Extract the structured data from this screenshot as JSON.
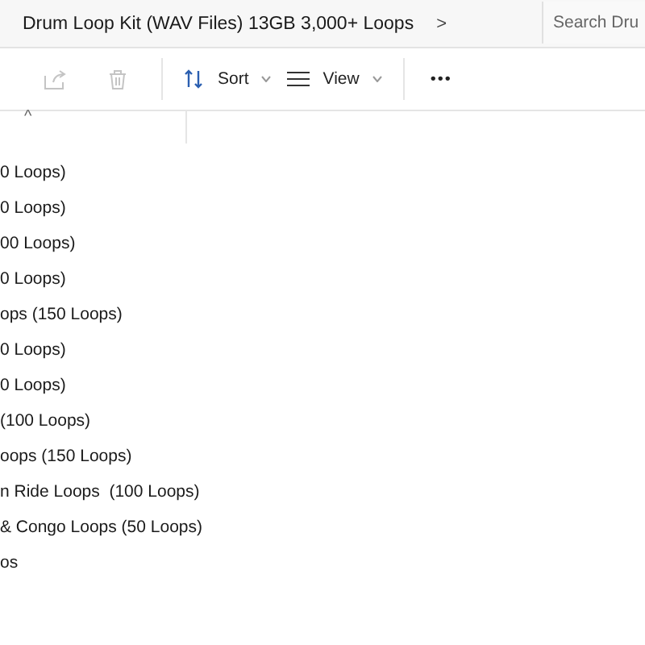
{
  "address_bar": {
    "path": "Drum Loop Kit (WAV Files) 13GB 3,000+ Loops",
    "chevron": ">"
  },
  "search": {
    "placeholder": "Search Dru"
  },
  "toolbar": [
    {
      "kind": "share",
      "disabled": true
    },
    {
      "kind": "delete",
      "disabled": true
    },
    {
      "kind": "sort",
      "label": "Sort"
    },
    {
      "kind": "view",
      "label": "View"
    },
    {
      "kind": "more",
      "label": "•••"
    }
  ],
  "sort_indicator": "^",
  "files": [
    {
      "name": "0 Loops)"
    },
    {
      "name": "0 Loops)"
    },
    {
      "name": "00 Loops)"
    },
    {
      "name": "0 Loops)"
    },
    {
      "name": "ops (150 Loops)"
    },
    {
      "name": "0 Loops)"
    },
    {
      "name": "0 Loops)"
    },
    {
      "name": "(100 Loops)"
    },
    {
      "name": "oops (150 Loops)"
    },
    {
      "name": "n Ride Loops  (100 Loops)"
    },
    {
      "name": "& Congo Loops (50 Loops)"
    },
    {
      "name": "os"
    }
  ]
}
